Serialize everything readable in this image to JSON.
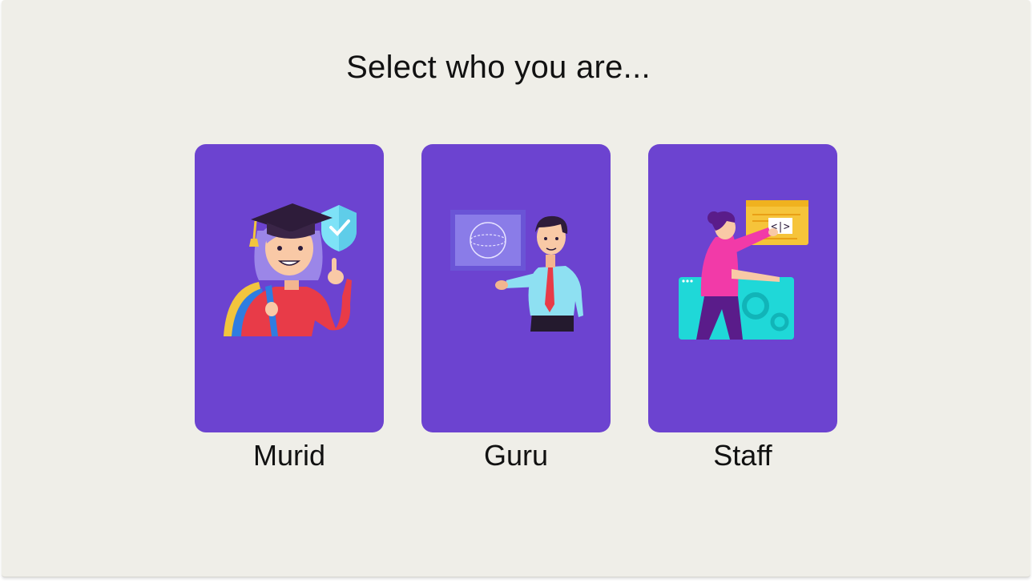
{
  "page": {
    "title": "Select who you are..."
  },
  "roles": [
    {
      "label": "Murid",
      "illustration": "student-graduate-illustration"
    },
    {
      "label": "Guru",
      "illustration": "teacher-presenting-illustration"
    },
    {
      "label": "Staff",
      "illustration": "staff-developer-illustration"
    }
  ],
  "colors": {
    "background": "#efeee8",
    "card": "#6c43d0",
    "text": "#111111"
  }
}
